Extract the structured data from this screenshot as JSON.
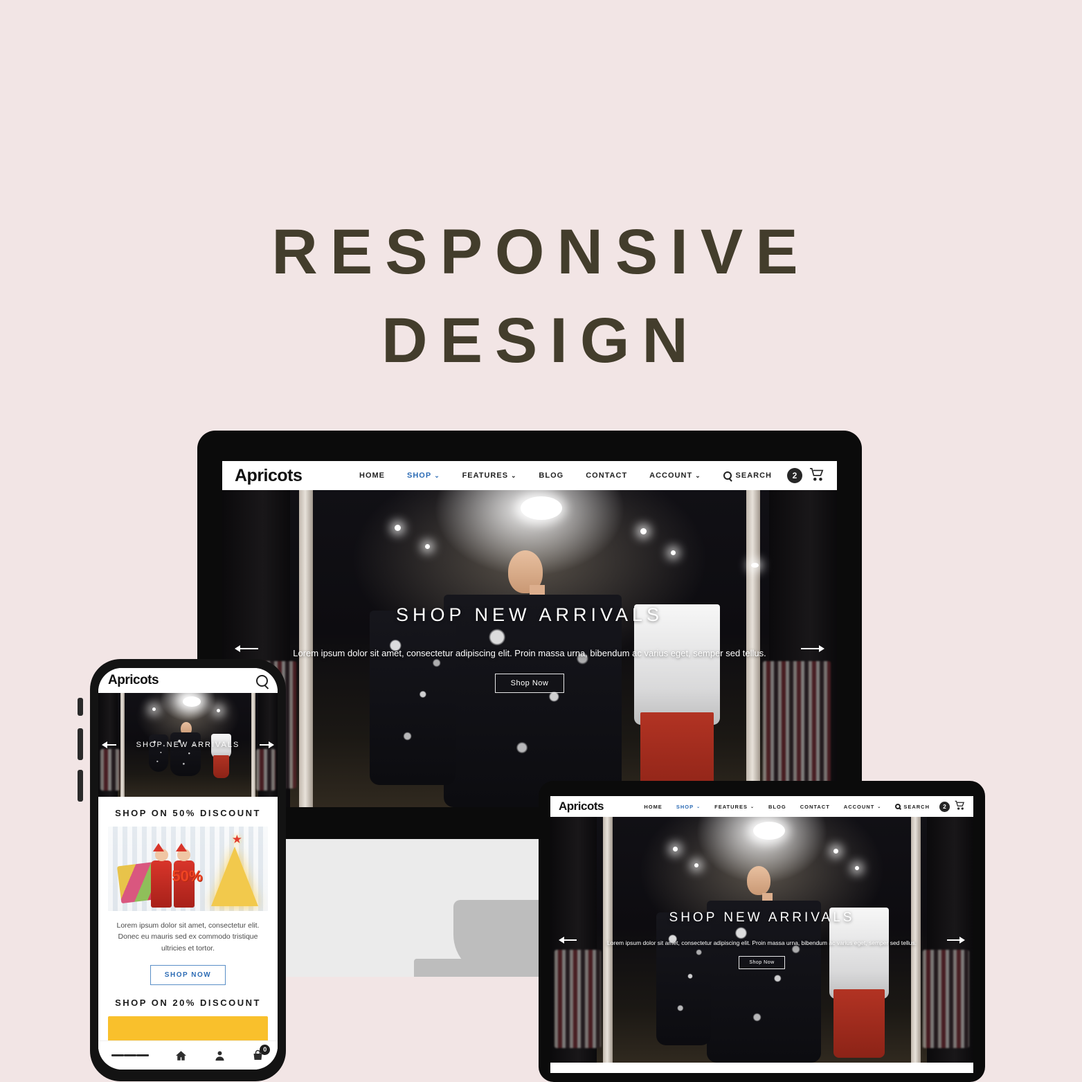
{
  "page": {
    "headline_line1": "RESPONSIVE",
    "headline_line2": "DESIGN",
    "background_color": "#f2e5e5",
    "headline_color": "#433d2c"
  },
  "site": {
    "brand": "Apricots",
    "accent_color": "#2d6cb5",
    "nav": [
      {
        "label": "HOME",
        "has_caret": false,
        "accent": false
      },
      {
        "label": "SHOP",
        "has_caret": true,
        "accent": true
      },
      {
        "label": "FEATURES",
        "has_caret": true,
        "accent": false
      },
      {
        "label": "BLOG",
        "has_caret": false,
        "accent": false
      },
      {
        "label": "CONTACT",
        "has_caret": false,
        "accent": false
      },
      {
        "label": "ACCOUNT",
        "has_caret": true,
        "accent": false
      }
    ],
    "search_label": "SEARCH",
    "cart_count": "2",
    "caret_glyph": "⌄"
  },
  "hero": {
    "title": "SHOP NEW ARRIVALS",
    "subtitle": "Lorem ipsum dolor sit amet, consectetur adipiscing elit. Proin massa urna, bibendum ac varius eget, semper sed tellus.",
    "button_label": "Shop Now",
    "prev_arrow": "left-arrow-icon",
    "next_arrow": "right-arrow-icon"
  },
  "phone": {
    "brand": "Apricots",
    "search_icon": "search-icon",
    "hero_title": "SHOP NEW ARRIVALS",
    "promo1_heading": "SHOP  ON  50%  DISCOUNT",
    "promo1_badge": "50%",
    "promo_text": "Lorem ipsum dolor sit amet, consectetur elit. Donec eu mauris sed ex commodo tristique ultricies et tortor.",
    "promo_button": "SHOP NOW",
    "promo2_heading": "SHOP  ON  20%  DISCOUNT",
    "banner_color": "#f9c02c",
    "tabbar": [
      {
        "name": "menu",
        "glyph": ""
      },
      {
        "name": "home",
        "glyph": "⌂"
      },
      {
        "name": "account",
        "glyph": "♟"
      },
      {
        "name": "bag",
        "glyph": ""
      }
    ],
    "bag_count": "0"
  },
  "colors": {
    "device_frame": "#0b0b0b",
    "desk_surface": "#ebebeb",
    "monitor_stand": "#bdbdbd",
    "accent_blue": "#2d6cb5",
    "yellow": "#f9c02c"
  }
}
